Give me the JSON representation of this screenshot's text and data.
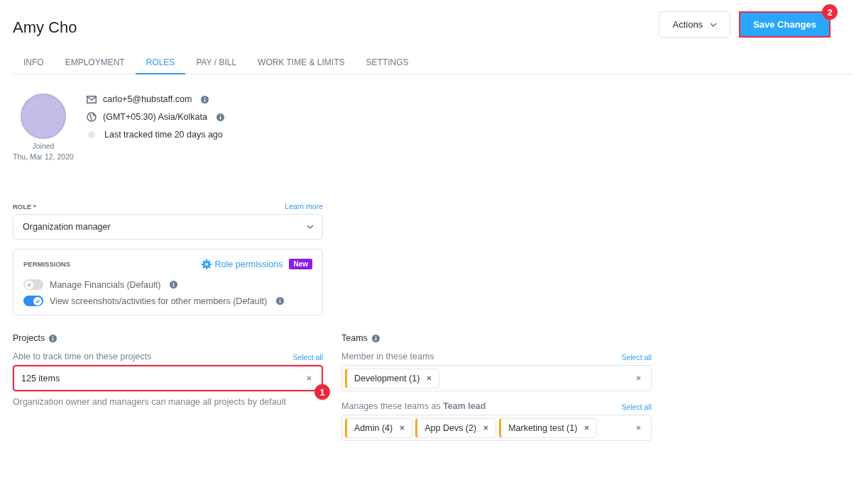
{
  "header": {
    "title": "Amy Cho",
    "actions_button": "Actions",
    "save_button": {
      "label": "Save Changes",
      "highlighted": true,
      "callout": "2"
    }
  },
  "tabs": [
    {
      "label": "INFO",
      "selected": false
    },
    {
      "label": "EMPLOYMENT",
      "selected": false
    },
    {
      "label": "ROLES",
      "selected": true
    },
    {
      "label": "PAY / BILL",
      "selected": false
    },
    {
      "label": "WORK TIME & LIMITS",
      "selected": false
    },
    {
      "label": "SETTINGS",
      "selected": false
    }
  ],
  "profile": {
    "joined_label": "Joined",
    "joined_date": "Thu, Mar 12, 2020",
    "details": [
      {
        "kind": "email",
        "text": "carlo+5@hubstaff.com",
        "info": true
      },
      {
        "kind": "timezone",
        "text": "(GMT+05:30) Asia/Kolkata",
        "info": true
      },
      {
        "kind": "status",
        "text": "Last tracked time 20 days ago",
        "info": false
      }
    ]
  },
  "role": {
    "label": "ROLE *",
    "learn_more": "Learn more",
    "value": "Organization manager"
  },
  "permissions": {
    "title": "PERMISSIONS",
    "link": "Role permissions",
    "badge": "New",
    "items": [
      {
        "label": "Manage Financials (Default)",
        "on": false
      },
      {
        "label": "View screenshots/activities for other members (Default)",
        "on": true
      }
    ]
  },
  "projects": {
    "title": "Projects",
    "hint": "Able to track time on these projects",
    "select_all": "Select all",
    "value": "125 items",
    "highlighted": true,
    "callout": "1",
    "note": "Organization owner and managers can manage all projects by default"
  },
  "teams": {
    "title": "Teams",
    "groups": [
      {
        "label": "Member in these teams",
        "select_all": "Select all",
        "chips": [
          "Development (1)"
        ]
      },
      {
        "label": "Manages these teams as **Team lead**",
        "select_all": "Select all",
        "chips": [
          "Admin (4)",
          "App Devs (2)",
          "Marketing test (1)"
        ]
      }
    ]
  }
}
